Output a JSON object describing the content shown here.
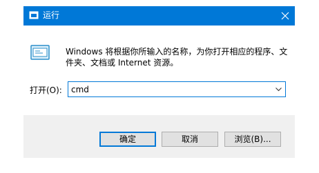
{
  "window": {
    "title": "运行",
    "title_icon": "run-icon",
    "accent": "#0078d7"
  },
  "dialog": {
    "description": "Windows 将根据你所输入的名称，为你打开相应的程序、文件夹、文档或 Internet 资源。",
    "app_icon": "run-dialog-icon"
  },
  "open_field": {
    "label": "打开(O):",
    "value": "cmd"
  },
  "buttons": {
    "ok": "确定",
    "cancel": "取消",
    "browse": "浏览(B)..."
  }
}
